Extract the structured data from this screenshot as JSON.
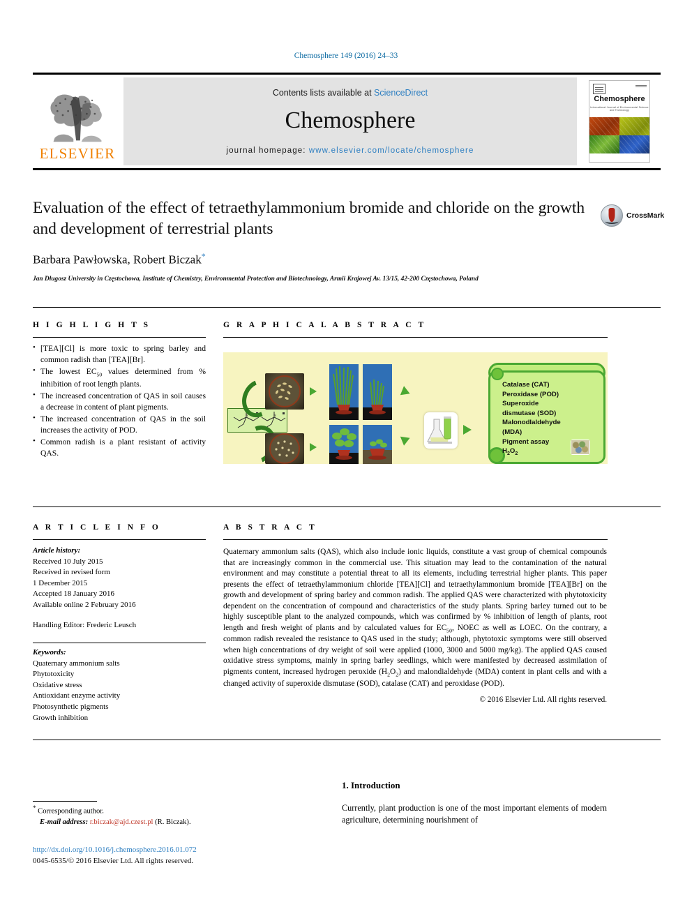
{
  "running_head": "Chemosphere 149 (2016) 24–33",
  "masthead": {
    "publisher_logo_label": "ELSEVIER",
    "contents_prefix": "Contents lists available at",
    "contents_link": "ScienceDirect",
    "journal_title": "Chemosphere",
    "homepage_prefix": "journal homepage:",
    "homepage_url": "www.elsevier.com/locate/chemosphere",
    "cover": {
      "name": "Chemosphere",
      "subtitle": "International Journal of Environmental Science and Technology"
    }
  },
  "article": {
    "title": "Evaluation of the effect of tetraethylammonium bromide and chloride on the growth and development of terrestrial plants",
    "authors": "Barbara Pawłowska, Robert Biczak",
    "corresponding_marker": "*",
    "affiliation": "Jan Długosz University in Częstochowa, Institute of Chemistry, Environmental Protection and Biotechnology, Armii Krajowej Av. 13/15, 42-200 Częstochowa, Poland",
    "crossmark_label": "CrossMark"
  },
  "sections": {
    "highlights": "H I G H L I G H T S",
    "graphical_abstract": "G R A P H I C A L   A B S T R A C T",
    "article_info": "A R T I C L E   I N F O",
    "abstract": "A B S T R A C T"
  },
  "highlights": [
    {
      "pre": "[TEA][Cl] is more toxic to spring barley and common radish than [TEA][Br]."
    },
    {
      "pre": "The lowest EC",
      "sub": "50",
      "post": " values determined from % inhibition of root length plants."
    },
    {
      "pre": "The increased concentration of QAS in soil causes a decrease in content of plant pigments."
    },
    {
      "pre": "The increased concentration of QAS in the soil increases the activity of POD."
    },
    {
      "pre": "Common radish is a plant resistant of activity QAS."
    }
  ],
  "graphical_abstract_items": [
    "Catalase (CAT)",
    "Peroxidase (POD)",
    "Superoxide",
    "dismutase (SOD)",
    "Malonodlaldehyde",
    "(MDA)",
    "Pigment assay"
  ],
  "graphical_abstract_formula": "H2O2",
  "article_info": {
    "history_label": "Article history:",
    "received": "Received 10 July 2015",
    "revised_label": "Received in revised form",
    "revised_date": "1 December 2015",
    "accepted": "Accepted 18 January 2016",
    "available": "Available online 2 February 2016",
    "handling_editor": "Handling Editor: Frederic Leusch",
    "keywords_label": "Keywords:",
    "keywords": [
      "Quaternary ammonium salts",
      "Phytotoxicity",
      "Oxidative stress",
      "Antioxidant enzyme activity",
      "Photosynthetic pigments",
      "Growth inhibition"
    ]
  },
  "abstract_text": {
    "p1": "Quaternary ammonium salts (QAS), which also include ionic liquids, constitute a vast group of chemical compounds that are increasingly common in the commercial use. This situation may lead to the contamination of the natural environment and may constitute a potential threat to all its elements, including terrestrial higher plants. This paper presents the effect of tetraethylammonium chloride [TEA][Cl] and tetraethylammonium bromide [TEA][Br] on the growth and development of spring barley and common radish. The applied QAS were characterized with phytotoxicity dependent on the concentration of compound and characteristics of the study plants. Spring barley turned out to be highly susceptible plant to the analyzed compounds, which was confirmed by % inhibition of length of plants, root length and fresh weight of plants and by calculated values for EC",
    "sub1": "50",
    "p2": ", NOEC as well as LOEC. On the contrary, a common radish revealed the resistance to QAS used in the study; although, phytotoxic symptoms were still observed when high concentrations of dry weight of soil were applied (1000, 3000 and 5000 mg/kg). The applied QAS caused oxidative stress symptoms, mainly in spring barley seedlings, which were manifested by decreased assimilation of pigments content, increased hydrogen peroxide (H",
    "sub2": "2",
    "p3": "O",
    "sub3": "2",
    "p4": ") and malondialdehyde (MDA) content in plant cells and with a changed activity of superoxide dismutase (SOD), catalase (CAT) and peroxidase (POD)."
  },
  "copyright": "© 2016 Elsevier Ltd. All rights reserved.",
  "introduction": {
    "heading": "1. Introduction",
    "paragraph": "Currently, plant production is one of the most important elements of modern agriculture, determining nourishment of"
  },
  "footer": {
    "corresponding_star": "*",
    "corresponding_label": "Corresponding author.",
    "email_label": "E-mail address:",
    "email": "r.biczak@ajd.czest.pl",
    "email_owner": "(R. Biczak).",
    "doi": "http://dx.doi.org/10.1016/j.chemosphere.2016.01.072",
    "issn_line": "0045-6535/© 2016 Elsevier Ltd. All rights reserved."
  },
  "colors": {
    "link_blue": "#2e7fc1",
    "elsevier_orange": "#f08000",
    "ga_background": "#f7f4c0",
    "ga_green": "#4aa832"
  }
}
